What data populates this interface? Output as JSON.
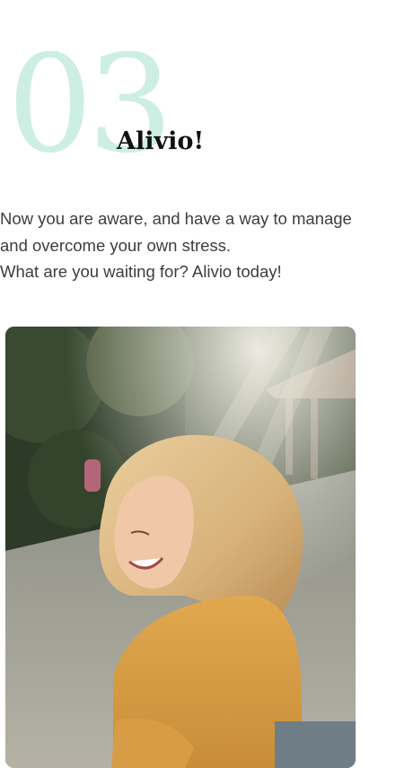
{
  "section": {
    "number": "03",
    "title": "Alivio!",
    "description": [
      "Now you are aware, and have a way to manage",
      "and overcome your own stress.",
      "What are you waiting for? Alivio today!"
    ]
  },
  "photo": {
    "subject": "smiling-woman-photo"
  },
  "colors": {
    "number": "#cdeee3",
    "title": "#111111",
    "text": "#3d3d3d",
    "background": "#ffffff"
  }
}
